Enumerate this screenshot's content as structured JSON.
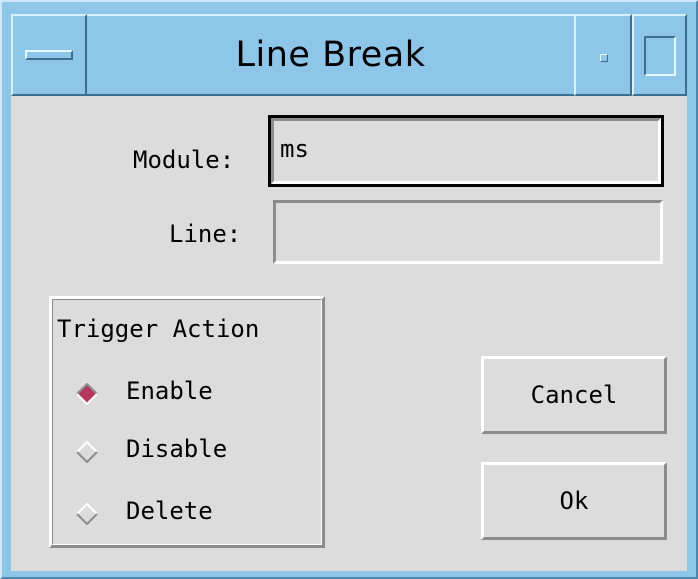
{
  "window": {
    "title": "Line Break",
    "menu_icon": "window-menu-icon",
    "minimize_icon": "minimize-icon",
    "maximize_icon": "maximize-icon"
  },
  "form": {
    "module_label": "Module:",
    "module_value": "ms",
    "line_label": "Line:",
    "line_value": ""
  },
  "trigger_action": {
    "title": "Trigger Action",
    "options": [
      {
        "label": "Enable",
        "selected": true
      },
      {
        "label": "Disable",
        "selected": false
      },
      {
        "label": "Delete",
        "selected": false
      }
    ]
  },
  "buttons": {
    "cancel_label": "Cancel",
    "ok_label": "Ok"
  },
  "colors": {
    "title_bar": "#8ec6ea",
    "client_bg": "#dcdcdc",
    "radio_selected": "#b6375e"
  }
}
